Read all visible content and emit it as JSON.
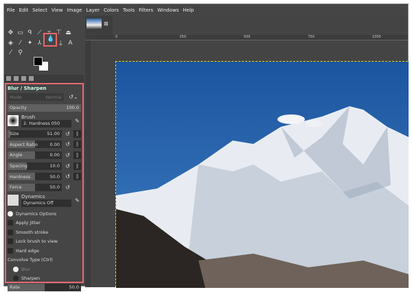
{
  "menu": [
    "File",
    "Edit",
    "Select",
    "View",
    "Image",
    "Layer",
    "Colors",
    "Tools",
    "Filters",
    "Windows",
    "Help"
  ],
  "ruler": [
    "0",
    "250",
    "500",
    "750",
    "1000"
  ],
  "options": {
    "title": "Blur / Sharpen",
    "mode_label": "Mode",
    "mode_value": "Normal",
    "opacity_label": "Opacity",
    "opacity_value": "100.0",
    "brush_label": "Brush",
    "brush_value": "2. Hardness 050",
    "params": [
      {
        "label": "Size",
        "value": "51.00",
        "fill": 0.05,
        "chain": true
      },
      {
        "label": "Aspect Ratio",
        "value": "0.00",
        "fill": 0.5,
        "chain": true
      },
      {
        "label": "Angle",
        "value": "0.00",
        "fill": 0.5,
        "chain": true
      },
      {
        "label": "Spacing",
        "value": "10.0",
        "fill": 0.35,
        "chain": true
      },
      {
        "label": "Hardness",
        "value": "50.0",
        "fill": 0.5,
        "chain": true
      },
      {
        "label": "Force",
        "value": "50.0",
        "fill": 0.5,
        "chain": false
      }
    ],
    "dynamics_label": "Dynamics",
    "dynamics_value": "Dynamics Off",
    "dynamics_options": "Dynamics Options",
    "checks": [
      "Apply Jitter",
      "Smooth stroke",
      "Lock brush to view",
      "Hard edge"
    ],
    "convolve_label": "Convolve Type  (Ctrl)",
    "convolve": [
      {
        "label": "Blur",
        "selected": true
      },
      {
        "label": "Sharpen",
        "selected": false
      }
    ],
    "rate_label": "Rate",
    "rate_value": "50.0"
  },
  "colors": {
    "accent": "#e86a72",
    "sky": "#1d5ba6"
  }
}
